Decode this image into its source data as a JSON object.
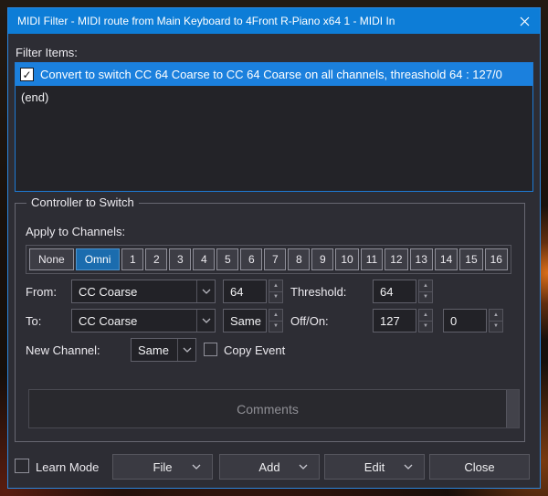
{
  "window": {
    "title": "MIDI Filter - MIDI route from Main Keyboard to 4Front R-Piano x64 1 - MIDI In"
  },
  "filter": {
    "label": "Filter Items:",
    "item1": "Convert to switch CC 64 Coarse to CC 64 Coarse on all channels, threashold 64 : 127/0",
    "item1_checked": "✓",
    "item2": "(end)"
  },
  "group": {
    "legend": "Controller to Switch",
    "apply_label": "Apply to Channels:",
    "channels": [
      "None",
      "Omni",
      "1",
      "2",
      "3",
      "4",
      "5",
      "6",
      "7",
      "8",
      "9",
      "10",
      "11",
      "12",
      "13",
      "14",
      "15",
      "16"
    ],
    "active_channel": "Omni",
    "from_label": "From:",
    "from_type": "CC Coarse",
    "from_value": "64",
    "threshold_label": "Threshold:",
    "threshold_value": "64",
    "to_label": "To:",
    "to_type": "CC Coarse",
    "to_value": "Same",
    "offon_label": "Off/On:",
    "off_value": "127",
    "on_value": "0",
    "new_channel_label": "New Channel:",
    "new_channel_value": "Same",
    "copy_event_label": "Copy Event",
    "comments_placeholder": "Comments"
  },
  "footer": {
    "learn_mode_label": "Learn Mode",
    "file_label": "File",
    "add_label": "Add",
    "edit_label": "Edit",
    "close_label": "Close"
  },
  "colors": {
    "titlebar": "#0d7dd7",
    "selection": "#1b80dd",
    "list_border": "#1e7ad4",
    "active_channel": "#1b6cae",
    "window_bg": "#2d2d34"
  }
}
